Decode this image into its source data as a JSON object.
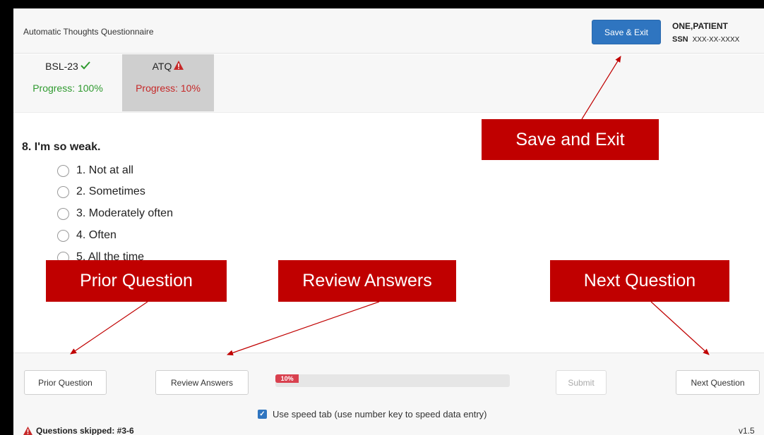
{
  "header": {
    "title": "Automatic Thoughts Questionnaire",
    "save_exit_label": "Save & Exit",
    "patient_name": "ONE,PATIENT",
    "ssn_label": "SSN",
    "ssn_value": "XXX-XX-XXXX"
  },
  "tabs": [
    {
      "name": "BSL-23",
      "status_icon": "check-icon",
      "progress_text": "Progress: 100%",
      "progress": 100
    },
    {
      "name": "ATQ",
      "status_icon": "warning-icon",
      "progress_text": "Progress: 10%",
      "progress": 10
    }
  ],
  "question": {
    "title": "8. I'm so weak.",
    "options": [
      "1. Not at all",
      "2. Sometimes",
      "3. Moderately often",
      "4. Often",
      "5. All the time"
    ]
  },
  "footer": {
    "prior_label": "Prior Question",
    "review_label": "Review Answers",
    "progress_label": "10%",
    "progress_fraction": 0.1,
    "submit_label": "Submit",
    "next_label": "Next Question",
    "speed_tab_label": "Use speed tab (use number key to speed data entry)",
    "speed_tab_checked": true,
    "skipped_text": "Questions skipped: #3-6",
    "version": "v1.5"
  },
  "annotations": {
    "save": "Save and Exit",
    "prior": "Prior Question",
    "review": "Review Answers",
    "next": "Next Question",
    "color": "#c00000"
  },
  "colors": {
    "primary": "#2f75c0",
    "success": "#2f9a2f",
    "danger": "#c62828",
    "progress": "#d9414f"
  }
}
